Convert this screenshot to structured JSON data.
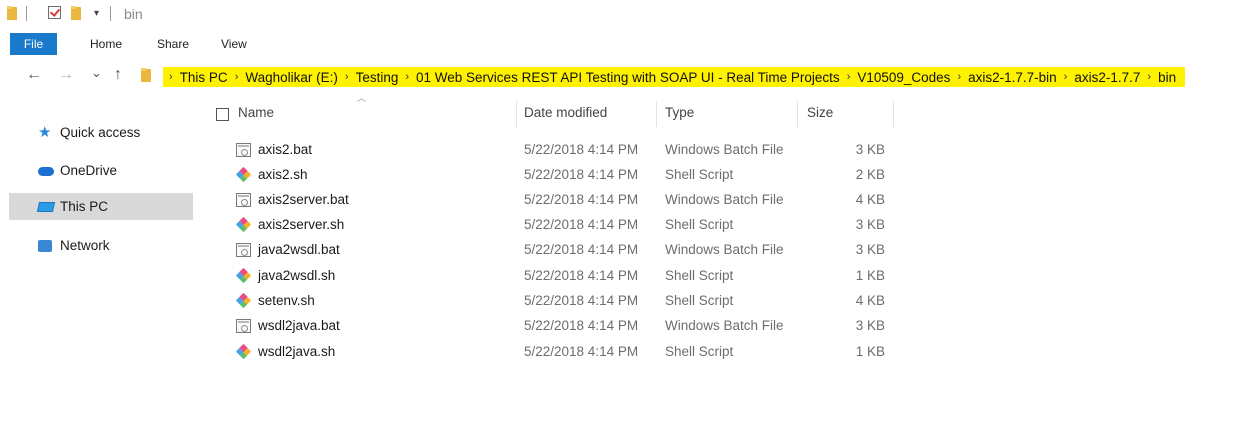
{
  "window": {
    "title": "bin"
  },
  "ribbon": {
    "tabs": [
      "File",
      "Home",
      "Share",
      "View"
    ]
  },
  "nav": {
    "back_icon": "←",
    "forward_icon": "→",
    "recent_icon": "⌄",
    "up_icon": "↑",
    "breadcrumbs": [
      "This PC",
      "Wagholikar (E:)",
      "Testing",
      "01 Web Services REST API Testing with SOAP UI - Real Time Projects",
      "V10509_Codes",
      "axis2-1.7.7-bin",
      "axis2-1.7.7",
      "bin"
    ],
    "highlight_color": "#fff200"
  },
  "sidebar": {
    "items": [
      {
        "label": "Quick access",
        "icon": "star-icon"
      },
      {
        "label": "OneDrive",
        "icon": "cloud-icon"
      },
      {
        "label": "This PC",
        "icon": "computer-icon",
        "selected": true
      },
      {
        "label": "Network",
        "icon": "network-icon"
      }
    ]
  },
  "columns": {
    "name": "Name",
    "date": "Date modified",
    "type": "Type",
    "size": "Size"
  },
  "files": [
    {
      "name": "axis2.bat",
      "date": "5/22/2018 4:14 PM",
      "type": "Windows Batch File",
      "size": "3 KB",
      "icon": "batch-file-icon"
    },
    {
      "name": "axis2.sh",
      "date": "5/22/2018 4:14 PM",
      "type": "Shell Script",
      "size": "2 KB",
      "icon": "shell-script-icon"
    },
    {
      "name": "axis2server.bat",
      "date": "5/22/2018 4:14 PM",
      "type": "Windows Batch File",
      "size": "4 KB",
      "icon": "batch-file-icon"
    },
    {
      "name": "axis2server.sh",
      "date": "5/22/2018 4:14 PM",
      "type": "Shell Script",
      "size": "3 KB",
      "icon": "shell-script-icon"
    },
    {
      "name": "java2wsdl.bat",
      "date": "5/22/2018 4:14 PM",
      "type": "Windows Batch File",
      "size": "3 KB",
      "icon": "batch-file-icon"
    },
    {
      "name": "java2wsdl.sh",
      "date": "5/22/2018 4:14 PM",
      "type": "Shell Script",
      "size": "1 KB",
      "icon": "shell-script-icon"
    },
    {
      "name": "setenv.sh",
      "date": "5/22/2018 4:14 PM",
      "type": "Shell Script",
      "size": "4 KB",
      "icon": "shell-script-icon"
    },
    {
      "name": "wsdl2java.bat",
      "date": "5/22/2018 4:14 PM",
      "type": "Windows Batch File",
      "size": "3 KB",
      "icon": "batch-file-icon"
    },
    {
      "name": "wsdl2java.sh",
      "date": "5/22/2018 4:14 PM",
      "type": "Shell Script",
      "size": "1 KB",
      "icon": "shell-script-icon"
    }
  ]
}
